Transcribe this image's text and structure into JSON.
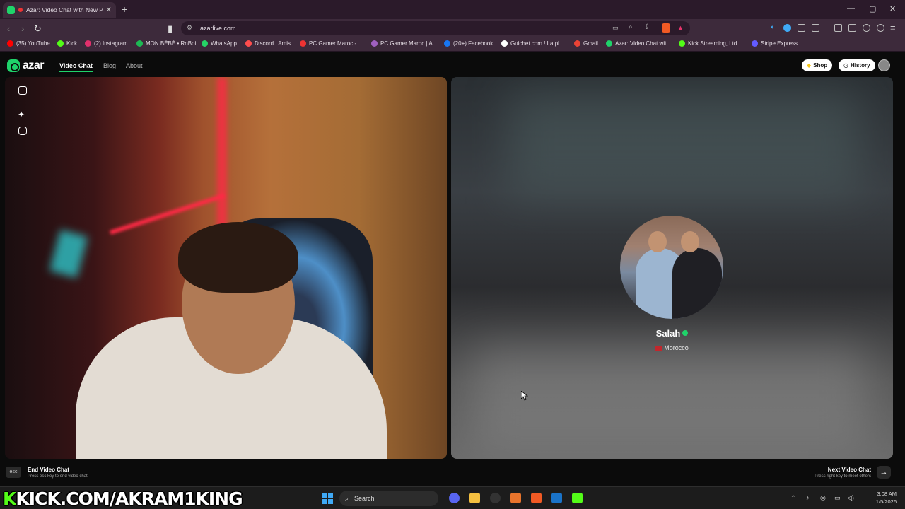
{
  "browser": {
    "tab_title": "Azar: Video Chat with New Pe",
    "new_tab": "+",
    "url": "azarlive.com",
    "window_controls": {
      "minimize": "—",
      "maximize": "▢",
      "close": "✕"
    }
  },
  "bookmarks": [
    {
      "label": "(35) YouTube",
      "color": "#ff0000"
    },
    {
      "label": "Kick",
      "color": "#53fc18"
    },
    {
      "label": "(2) Instagram",
      "color": "#e1306c"
    },
    {
      "label": "MON BÉBÉ • RnBoi",
      "color": "#1db954"
    },
    {
      "label": "WhatsApp",
      "color": "#25d366"
    },
    {
      "label": "Discord | Amis",
      "color": "#ff4d4d"
    },
    {
      "label": "PC Gamer Maroc -...",
      "color": "#e33"
    },
    {
      "label": "PC Gamer Maroc | A...",
      "color": "#a060c0"
    },
    {
      "label": "(20+) Facebook",
      "color": "#1877f2"
    },
    {
      "label": "Guichet.com ! La pl...",
      "color": "#ffffff"
    },
    {
      "label": "Gmail",
      "color": "#ea4335"
    },
    {
      "label": "Azar: Video Chat wit...",
      "color": "#1fd36a"
    },
    {
      "label": "Kick Streaming, Ltd....",
      "color": "#53fc18"
    },
    {
      "label": "Stripe Express",
      "color": "#635bff"
    }
  ],
  "site": {
    "logo": "azar",
    "nav": {
      "video_chat": "Video Chat",
      "blog": "Blog",
      "about": "About"
    },
    "shop": "Shop",
    "history": "History",
    "accent": "#1fd36a"
  },
  "remote": {
    "name": "Salah",
    "country": "Morocco"
  },
  "footer": {
    "esc_key": "esc",
    "end_title": "End Video Chat",
    "end_sub": "Press esc key to end video chat",
    "next_title": "Next Video Chat",
    "next_sub": "Press right key to meet others",
    "next_arrow": "→"
  },
  "taskbar": {
    "watermark_k": "K",
    "watermark_rest": "KICK.COM/AKRAM1KING",
    "search": "Search",
    "time": "3:08 AM",
    "date": "1/5/2026"
  }
}
